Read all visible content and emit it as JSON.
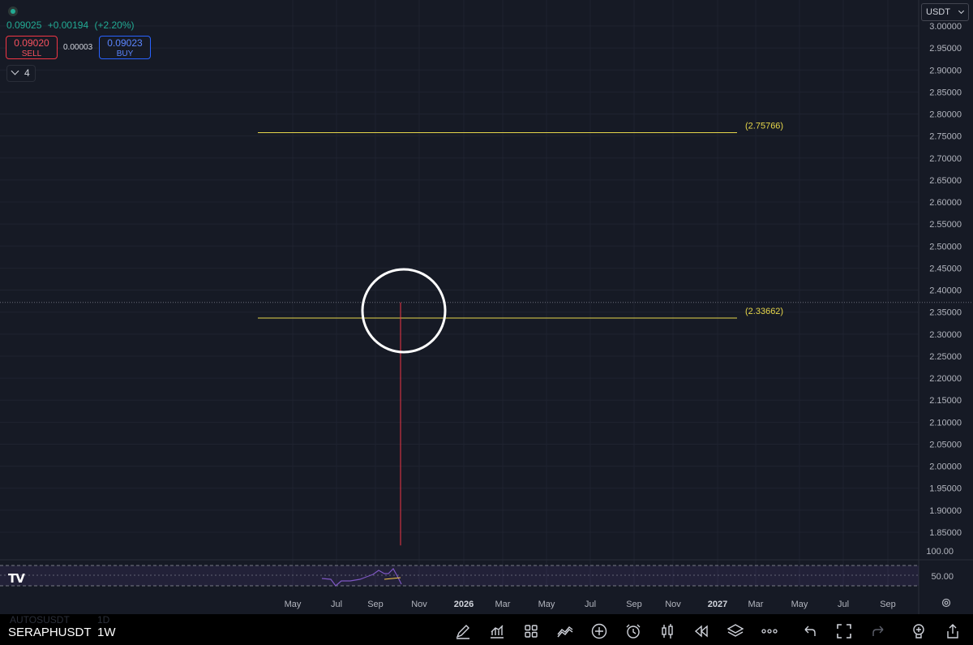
{
  "quote": {
    "last": "0.09025",
    "change": "+0.00194",
    "change_pct": "(+2.20%)",
    "sell_price": "0.09020",
    "sell_label": "SELL",
    "buy_price": "0.09023",
    "buy_label": "BUY",
    "spread": "0.00003"
  },
  "collapse": {
    "count": "4"
  },
  "currency": {
    "selected": "USDT"
  },
  "price_axis": {
    "ticks": [
      "3.00000",
      "2.95000",
      "2.90000",
      "2.85000",
      "2.80000",
      "2.75000",
      "2.70000",
      "2.65000",
      "2.60000",
      "2.55000",
      "2.50000",
      "2.45000",
      "2.40000",
      "2.35000",
      "2.30000",
      "2.25000",
      "2.20000",
      "2.15000",
      "2.10000",
      "2.05000",
      "2.00000",
      "1.95000",
      "1.90000",
      "1.85000"
    ]
  },
  "time_axis": {
    "labels": [
      "May",
      "Jul",
      "Sep",
      "Nov",
      "2026",
      "Mar",
      "May",
      "Jul",
      "Sep",
      "Nov",
      "2027",
      "Mar",
      "May",
      "Jul",
      "Sep"
    ],
    "bold": [
      "2026",
      "2027"
    ]
  },
  "drawings": {
    "levels": [
      {
        "label": "(2.75766)",
        "value": 2.75766
      },
      {
        "label": "(2.33662)",
        "value": 2.33662
      }
    ],
    "circle_highlight": true
  },
  "candle": {
    "high": 2.372,
    "low": 1.82
  },
  "crosshair_price": 2.372,
  "rsi": {
    "ticks": [
      "100.00",
      "50.00"
    ]
  },
  "bottom_bar": {
    "symbol": "SERAPHUSDT",
    "timeframe": "1W",
    "ghost_symbol": "AUTOSUSDT",
    "ghost_timeframe": "1D",
    "tools": [
      "pen-icon",
      "chart-type-icon",
      "grid-icon",
      "indicators-icon",
      "add-icon",
      "alarm-icon",
      "candles-icon",
      "replay-icon",
      "layers-icon",
      "more-icon",
      "undo-icon",
      "fullscreen-icon",
      "redo-icon",
      "bulb-icon",
      "share-icon"
    ]
  },
  "colors": {
    "background": "#161a25",
    "level_line": "#e6d64a",
    "candle": "#f23645",
    "up": "#22ab94",
    "rsi": "#7e57c2"
  }
}
